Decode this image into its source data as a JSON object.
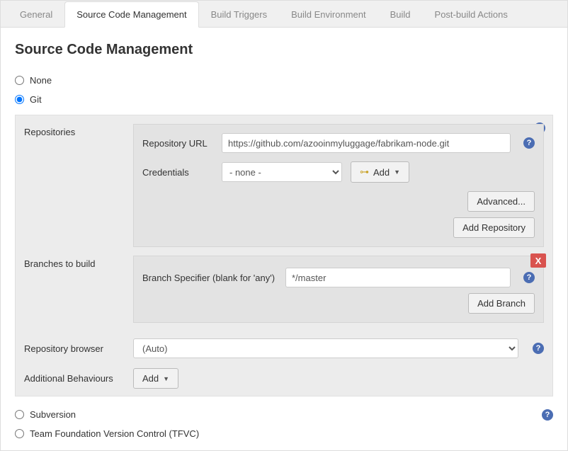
{
  "tabs": {
    "general": "General",
    "scm": "Source Code Management",
    "triggers": "Build Triggers",
    "env": "Build Environment",
    "build": "Build",
    "post": "Post-build Actions"
  },
  "heading": "Source Code Management",
  "scm_options": {
    "none": "None",
    "git": "Git",
    "svn": "Subversion",
    "tfvc": "Team Foundation Version Control (TFVC)"
  },
  "labels": {
    "repositories": "Repositories",
    "repo_url": "Repository URL",
    "credentials": "Credentials",
    "advanced": "Advanced...",
    "add_repo": "Add Repository",
    "branches": "Branches to build",
    "branch_spec": "Branch Specifier (blank for 'any')",
    "add_branch": "Add Branch",
    "repo_browser": "Repository browser",
    "add_behaviours": "Additional Behaviours",
    "add": "Add",
    "cred_add": "Add"
  },
  "values": {
    "repo_url": "https://github.com/azooinmyluggage/fabrikam-node.git",
    "credentials_selected": "- none -",
    "branch_spec": "*/master",
    "repo_browser_selected": "(Auto)"
  },
  "glyphs": {
    "help": "?",
    "close": "X",
    "caret": "▼",
    "key": "⊶"
  }
}
